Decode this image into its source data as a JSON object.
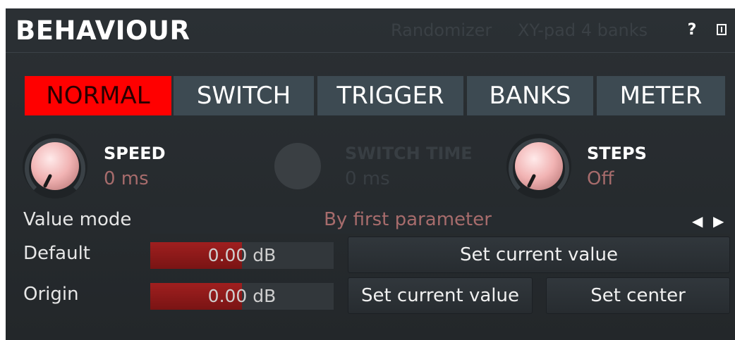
{
  "header": {
    "title": "BEHAVIOUR",
    "links": [
      "Randomizer",
      "XY-pad 4 banks"
    ],
    "help_label": "?"
  },
  "tabs": [
    {
      "label": "NORMAL",
      "active": true
    },
    {
      "label": "SWITCH",
      "active": false
    },
    {
      "label": "TRIGGER",
      "active": false
    },
    {
      "label": "BANKS",
      "active": false
    },
    {
      "label": "METER",
      "active": false
    }
  ],
  "knobs": [
    {
      "label": "SPEED",
      "value": "0 ms",
      "enabled": true,
      "level": 0.0
    },
    {
      "label": "SWITCH TIME",
      "value": "0 ms",
      "enabled": false,
      "level": 0.0
    },
    {
      "label": "STEPS",
      "value": "Off",
      "enabled": true,
      "level": 0.0
    }
  ],
  "value_mode": {
    "label": "Value mode",
    "value": "By first parameter",
    "prev_icon": "triangle-left-icon",
    "next_icon": "triangle-right-icon"
  },
  "default_row": {
    "label": "Default",
    "value": "0.00 dB",
    "level": 0.5,
    "button": "Set current value"
  },
  "origin_row": {
    "label": "Origin",
    "value": "0.00 dB",
    "level": 0.5,
    "button_current": "Set current value",
    "button_center": "Set center"
  },
  "colors": {
    "accent": "#ff0000",
    "value_text": "#a76c6c",
    "panel_bg": "#2b3034"
  }
}
